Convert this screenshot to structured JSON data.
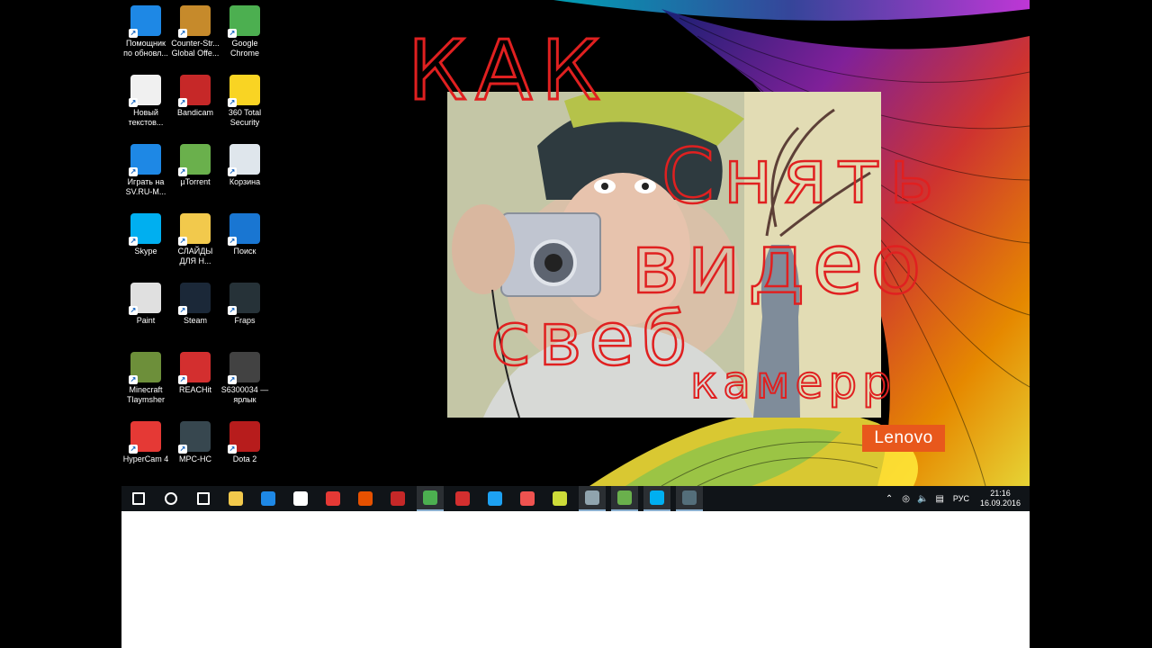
{
  "desktop_icons": [
    {
      "label": "Помощник по обновл...",
      "icon": "windows-update-icon",
      "color": "#1e88e5"
    },
    {
      "label": "Counter-Str... Global Offe...",
      "icon": "csgo-icon",
      "color": "#c68a2b"
    },
    {
      "label": "Google Chrome",
      "icon": "chrome-icon",
      "color": "#4caf50"
    },
    {
      "label": "Новый текстов...",
      "icon": "text-document-icon",
      "color": "#f0f0f0"
    },
    {
      "label": "Bandicam",
      "icon": "bandicam-icon",
      "color": "#c62828"
    },
    {
      "label": "360 Total Security",
      "icon": "360-security-icon",
      "color": "#f9d423"
    },
    {
      "label": "Играть на SV.RU-M...",
      "icon": "sv-ru-icon",
      "color": "#1e88e5"
    },
    {
      "label": "µTorrent",
      "icon": "utorrent-icon",
      "color": "#6ab04c"
    },
    {
      "label": "Корзина",
      "icon": "recycle-bin-icon",
      "color": "#dfe6ec"
    },
    {
      "label": "Skype",
      "icon": "skype-icon",
      "color": "#00aff0"
    },
    {
      "label": "СЛАЙДЫ ДЛЯ Н...",
      "icon": "folder-icon",
      "color": "#f2c94c"
    },
    {
      "label": "Поиск",
      "icon": "search-icon",
      "color": "#1976d2"
    },
    {
      "label": "Paint",
      "icon": "paint-icon",
      "color": "#e0e0e0"
    },
    {
      "label": "Steam",
      "icon": "steam-icon",
      "color": "#1b2838"
    },
    {
      "label": "Fraps",
      "icon": "fraps-icon",
      "color": "#263238"
    },
    {
      "label": "Minecraft Tlaymsher",
      "icon": "minecraft-icon",
      "color": "#6d8f3a"
    },
    {
      "label": "REACHit",
      "icon": "reachit-icon",
      "color": "#d32f2f"
    },
    {
      "label": "S6300034 — ярлык",
      "icon": "video-file-icon",
      "color": "#424242"
    },
    {
      "label": "HyperCam 4",
      "icon": "hypercam-icon",
      "color": "#e53935"
    },
    {
      "label": "MPC-HC",
      "icon": "mpc-hc-icon",
      "color": "#37474f"
    },
    {
      "label": "Dota 2",
      "icon": "dota2-icon",
      "color": "#b71c1c"
    }
  ],
  "overlay_text": {
    "word1": "КАК",
    "word2": "Снять",
    "word3": "видео",
    "word4": "свеб",
    "word5": "камерр",
    "color": "#e02020"
  },
  "brand": {
    "label": "Lenovo",
    "color": "#e8581c"
  },
  "taskbar": {
    "apps": [
      {
        "icon": "start-icon",
        "active": false
      },
      {
        "icon": "search-icon",
        "active": false
      },
      {
        "icon": "task-view-icon",
        "active": false
      },
      {
        "icon": "file-explorer-icon",
        "active": false
      },
      {
        "icon": "edge-icon",
        "active": false
      },
      {
        "icon": "store-icon",
        "active": false
      },
      {
        "icon": "mail-icon",
        "active": false
      },
      {
        "icon": "office-icon",
        "active": false
      },
      {
        "icon": "mcafee-icon",
        "active": false
      },
      {
        "icon": "chrome-icon",
        "active": true
      },
      {
        "icon": "bandicam-icon",
        "active": false
      },
      {
        "icon": "twitter-icon",
        "active": false
      },
      {
        "icon": "hypercam-icon",
        "active": false
      },
      {
        "icon": "fraps-icon",
        "active": false
      },
      {
        "icon": "movie-maker-icon",
        "active": true
      },
      {
        "icon": "utorrent-icon",
        "active": true
      },
      {
        "icon": "skype-icon",
        "active": true
      },
      {
        "icon": "steam-icon",
        "active": true
      }
    ],
    "language": "РУС",
    "time": "21:16",
    "date": "16.09.2016"
  }
}
